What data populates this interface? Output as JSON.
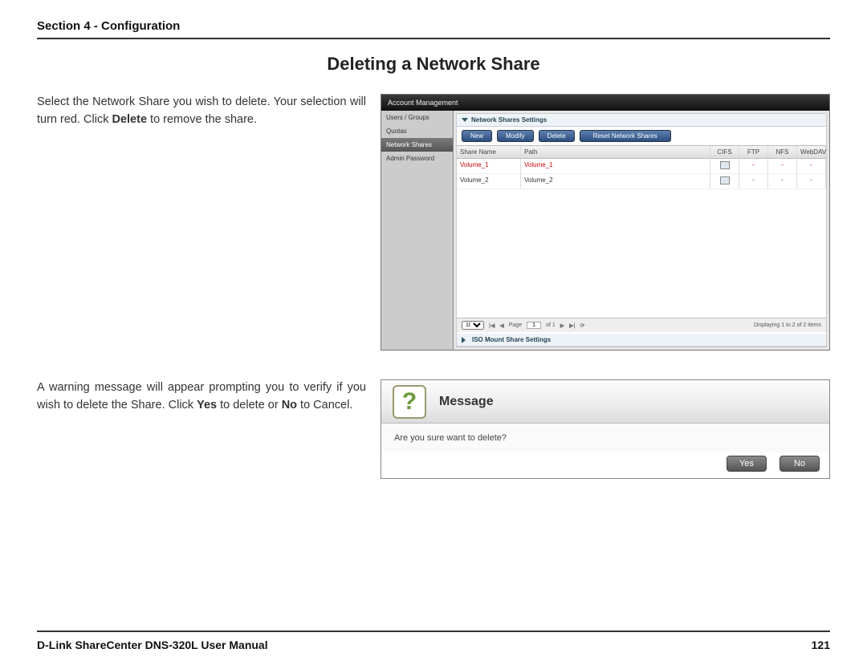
{
  "header": {
    "section": "Section 4 - Configuration"
  },
  "title": "Deleting a Network Share",
  "para1_pre": "Select the Network Share you wish to delete. Your selection will turn red. Click ",
  "para1_bold": "Delete",
  "para1_post": " to remove the share.",
  "para2_a": "A warning message will appear prompting you to verify if you wish to delete the Share. Click ",
  "para2_b1": "Yes",
  "para2_c": " to delete or ",
  "para2_b2": "No",
  "para2_d": " to Cancel.",
  "screenshot": {
    "topbar": "Account Management",
    "sidebar": {
      "items": [
        "Users / Groups",
        "Quotas",
        "Network Shares",
        "Admin Password"
      ],
      "selected_index": 2
    },
    "panel_title": "Network Shares Settings",
    "buttons": {
      "new": "New",
      "modify": "Modify",
      "delete": "Delete",
      "reset": "Reset Network Shares"
    },
    "columns": {
      "name": "Share Name",
      "path": "Path",
      "cifs": "CIFS",
      "ftp": "FTP",
      "nfs": "NFS",
      "webdav": "WebDAV"
    },
    "rows": [
      {
        "name": "Volume_1",
        "path": "Volume_1",
        "ftp": "-",
        "nfs": "-",
        "webdav": "-",
        "selected": true
      },
      {
        "name": "Volume_2",
        "path": "Volume_2",
        "ftp": "-",
        "nfs": "-",
        "webdav": "-",
        "selected": false
      }
    ],
    "pager": {
      "page_label": "Page",
      "page": "1",
      "of": "of 1",
      "summary": "Displaying 1 to 2 of 2 items",
      "perpage": "10"
    },
    "iso_title": "ISO Mount Share Settings"
  },
  "dialog": {
    "title": "Message",
    "body": "Are you sure want to delete?",
    "yes": "Yes",
    "no": "No",
    "qmark": "?"
  },
  "footer": {
    "manual": "D-Link ShareCenter DNS-320L User Manual",
    "page": "121"
  }
}
